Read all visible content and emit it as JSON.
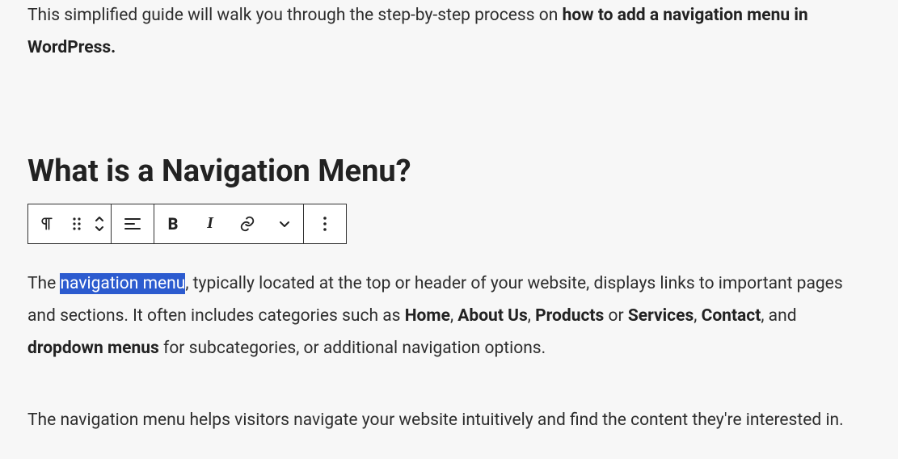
{
  "intro": {
    "prefix": "This simplified guide will walk you through the step-by-step process on ",
    "bold": "how to add a navigation menu in WordPress.",
    "suffix": ""
  },
  "heading": "What is a Navigation Menu?",
  "toolbar": {
    "blockType": "paragraph-block-icon",
    "drag": "drag-handle-icon",
    "move": "move-up-down-icon",
    "align": "align-left-icon",
    "bold": "B",
    "italic": "I",
    "link": "link-icon",
    "more": "chevron-down-icon",
    "options": "more-options-icon"
  },
  "paragraph1": {
    "t1": "The ",
    "selected": "navigation menu",
    "t2": ", typically located at the top or header of your website, displays links to important pages and sections. It often includes categories such as ",
    "b1": "Home",
    "c1": ", ",
    "b2": "About Us",
    "c2": ", ",
    "b3": "Products",
    "c3": " or ",
    "b4": "Services",
    "c4": ", ",
    "b5": "Contact",
    "c5": ", and ",
    "b6": "dropdown menus",
    "t3": " for subcategories, or additional navigation options."
  },
  "paragraph2": "The navigation menu helps visitors navigate your website intuitively and find the content they're interested in."
}
